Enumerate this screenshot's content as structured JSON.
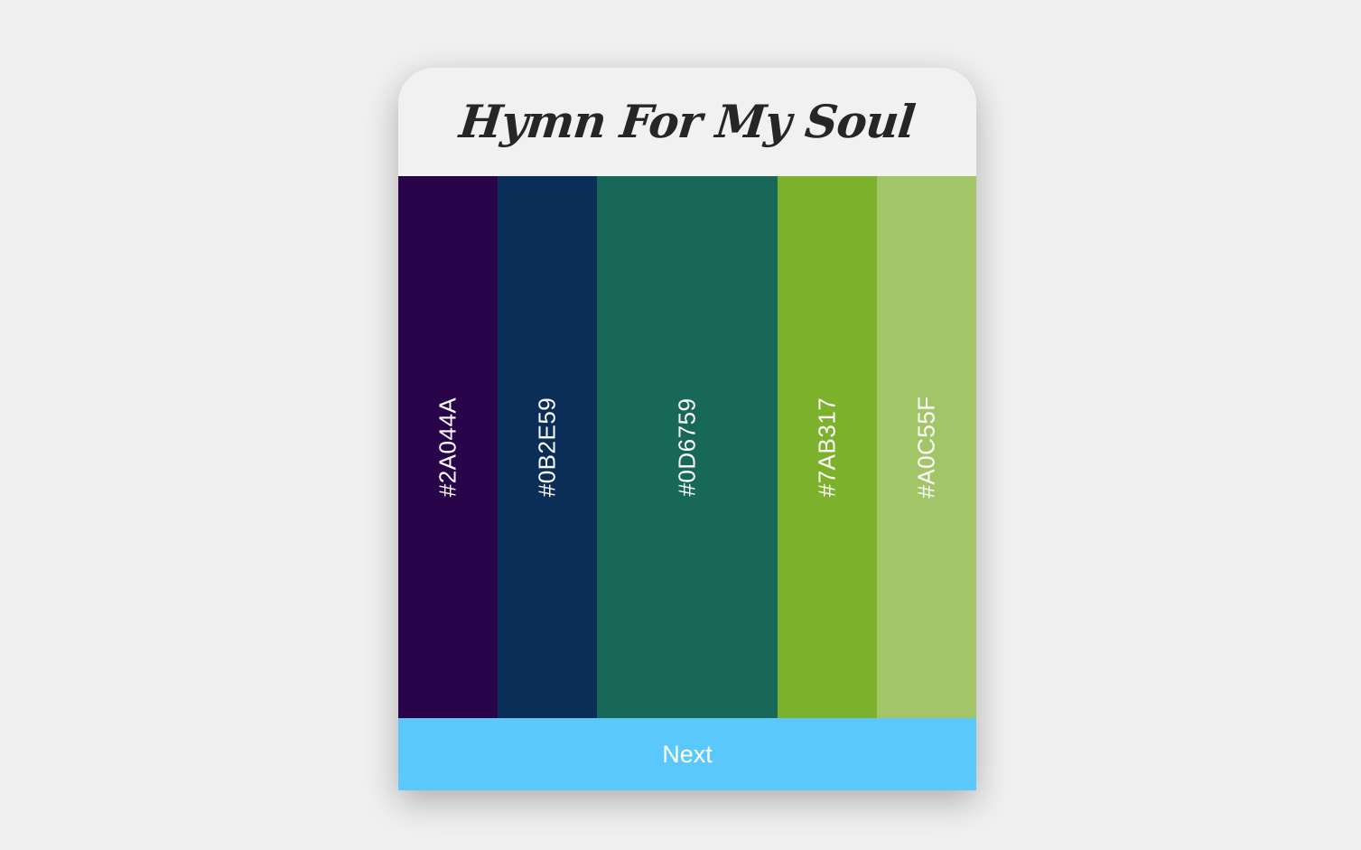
{
  "palette": {
    "title": "Hymn For My Soul",
    "swatches": [
      {
        "hex": "#2A044A",
        "color": "#2A044A"
      },
      {
        "hex": "#0B2E59",
        "color": "#0B2E59"
      },
      {
        "hex": "#0D6759",
        "color": "#176859"
      },
      {
        "hex": "#7AB317",
        "color": "#7CB12B"
      },
      {
        "hex": "#A0C55F",
        "color": "#A2C567"
      }
    ],
    "next_label": "Next",
    "next_color": "#5AC8FB"
  }
}
